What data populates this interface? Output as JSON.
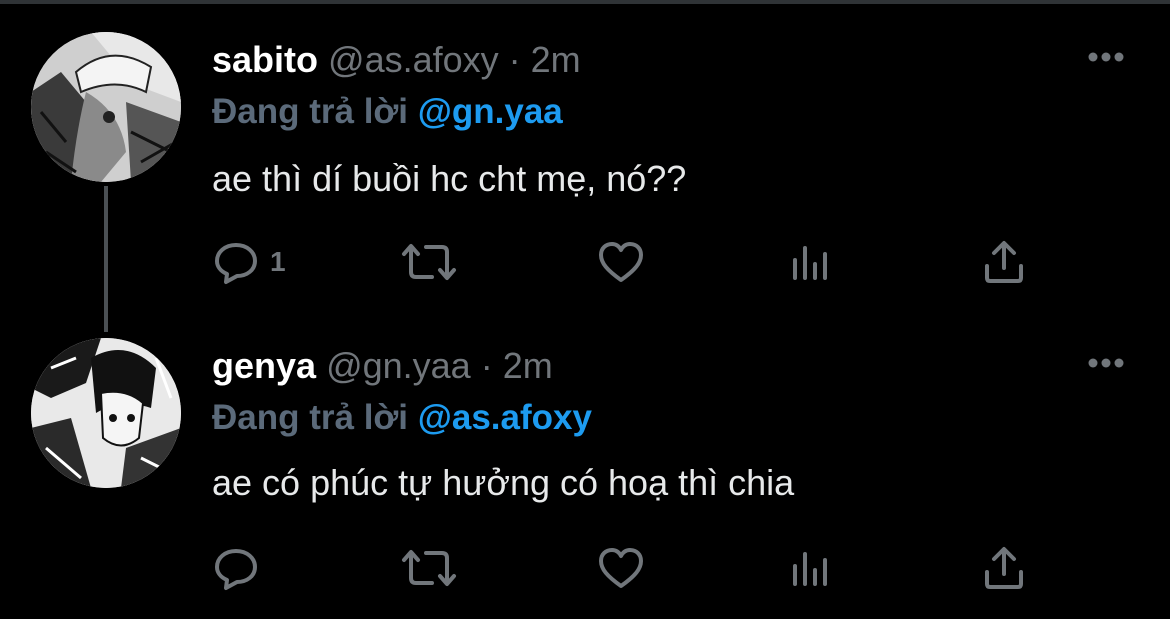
{
  "tweets": [
    {
      "display_name": "sabito",
      "handle": "@as.afoxy",
      "separator": " · ",
      "time": "2m",
      "reply_prefix": "Đang trả lời ",
      "reply_to": "@gn.yaa",
      "text": "ae thì dí buồi hc cht mẹ, nó??",
      "reply_count": "1"
    },
    {
      "display_name": "genya",
      "handle": "@gn.yaa",
      "separator": " · ",
      "time": "2m",
      "reply_prefix": "Đang trả lời ",
      "reply_to": "@as.afoxy",
      "text": "ae có phúc tự hưởng có hoạ thì chia",
      "reply_count": ""
    }
  ],
  "icons": {
    "reply": "reply-icon",
    "retweet": "retweet-icon",
    "like": "heart-icon",
    "views": "views-icon",
    "share": "share-icon",
    "more": "more-icon"
  },
  "colors": {
    "background": "#000000",
    "text": "#e7e9ea",
    "muted": "#71767b",
    "mention": "#1d9bf0"
  }
}
